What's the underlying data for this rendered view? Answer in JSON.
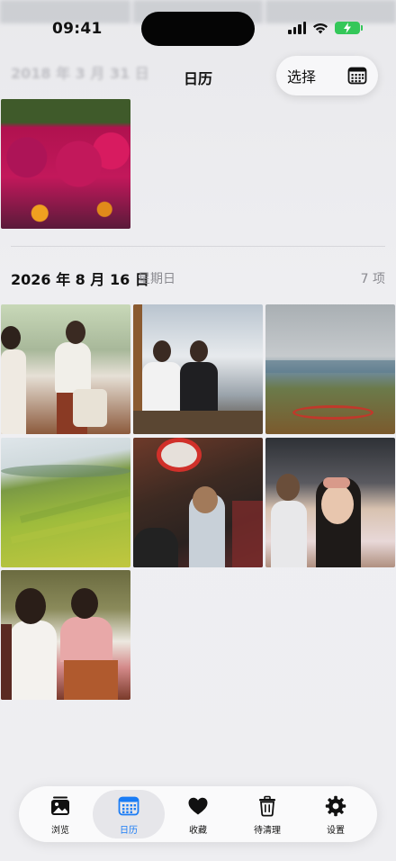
{
  "status_bar": {
    "time": "09:41"
  },
  "header": {
    "title": "日历",
    "faded_date": "2018 年 3 月 31 日",
    "select_label": "选择"
  },
  "section": {
    "date": "2026 年 8 月 16 日",
    "weekday": "星期日",
    "count": "7 项"
  },
  "tabs": [
    {
      "label": "浏览",
      "icon": "photo-stack-icon",
      "active": false
    },
    {
      "label": "日历",
      "icon": "calendar-icon",
      "active": true
    },
    {
      "label": "收藏",
      "icon": "heart-icon",
      "active": false
    },
    {
      "label": "待清理",
      "icon": "trash-icon",
      "active": false
    },
    {
      "label": "设置",
      "icon": "gear-icon",
      "active": false
    }
  ],
  "colors": {
    "accent": "#1a7cf5",
    "battery": "#34c759",
    "background": "#ededf0"
  }
}
